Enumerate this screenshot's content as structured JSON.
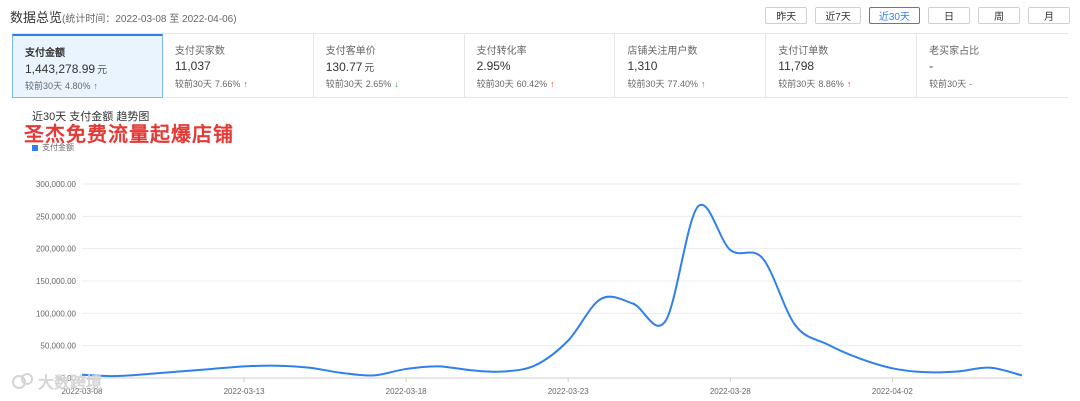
{
  "header": {
    "title": "数据总览",
    "range": "(统计时间：2022-03-08 至 2022-04-06)",
    "buttons": [
      {
        "label": "昨天",
        "active": false
      },
      {
        "label": "近7天",
        "active": false
      },
      {
        "label": "近30天",
        "active": true
      },
      {
        "label": "日",
        "active": false
      },
      {
        "label": "周",
        "active": false
      },
      {
        "label": "月",
        "active": false
      }
    ]
  },
  "metrics": [
    {
      "label": "支付金额",
      "value": "1,443,278.99",
      "unit": "元",
      "compare_label": "较前30天",
      "compare_value": "4.80%",
      "trend": "up",
      "active": true
    },
    {
      "label": "支付买家数",
      "value": "11,037",
      "unit": "",
      "compare_label": "较前30天",
      "compare_value": "7.66%",
      "trend": "up",
      "active": false
    },
    {
      "label": "支付客单价",
      "value": "130.77",
      "unit": "元",
      "compare_label": "较前30天",
      "compare_value": "2.65%",
      "trend": "down",
      "active": false
    },
    {
      "label": "支付转化率",
      "value": "2.95%",
      "unit": "",
      "compare_label": "较前30天",
      "compare_value": "60.42%",
      "trend": "up",
      "active": false
    },
    {
      "label": "店铺关注用户数",
      "value": "1,310",
      "unit": "",
      "compare_label": "较前30天",
      "compare_value": "77.40%",
      "trend": "up",
      "active": false
    },
    {
      "label": "支付订单数",
      "value": "11,798",
      "unit": "",
      "compare_label": "较前30天",
      "compare_value": "8.86%",
      "trend": "up",
      "active": false
    },
    {
      "label": "老买家占比",
      "value": "-",
      "unit": "",
      "compare_label": "较前30天",
      "compare_value": "-",
      "trend": "none",
      "active": false
    }
  ],
  "overlay_text": "圣杰免费流量起爆店铺",
  "watermark": "大数跨境",
  "colors": {
    "accent": "#2f80ed",
    "up": "#e53935",
    "down": "#2e9d4f"
  },
  "chart_data": {
    "type": "line",
    "title": "近30天 支付金额 趋势图",
    "series": [
      {
        "name": "支付金额",
        "values": [
          5000,
          3000,
          6000,
          10000,
          14000,
          18000,
          19000,
          16000,
          8000,
          4000,
          14000,
          18000,
          12000,
          10000,
          20000,
          58000,
          122000,
          115000,
          88000,
          265000,
          198000,
          185000,
          82000,
          52000,
          30000,
          15000,
          9000,
          10000,
          16000,
          4000
        ]
      }
    ],
    "x_ticks": [
      "2022-03-08",
      "2022-03-13",
      "2022-03-18",
      "2022-03-23",
      "2022-03-28",
      "2022-04-02"
    ],
    "y_ticks": [
      "0.00",
      "50,000.00",
      "100,000.00",
      "150,000.00",
      "200,000.00",
      "250,000.00",
      "300,000.00"
    ],
    "ylim": [
      0,
      300000
    ],
    "grid": true,
    "legend": "top-left"
  }
}
